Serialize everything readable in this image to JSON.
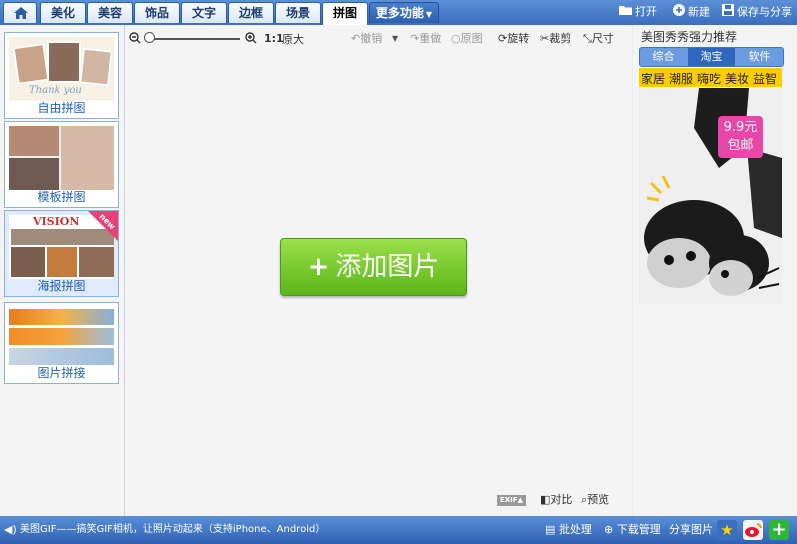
{
  "tabs": [
    "美化",
    "美容",
    "饰品",
    "文字",
    "边框",
    "场景",
    "拼图",
    "更多功能"
  ],
  "top_actions": {
    "open": "打开",
    "new": "新建",
    "save_share": "保存与分享"
  },
  "left_cards": [
    "自由拼图",
    "模板拼图",
    "海报拼图",
    "图片拼接"
  ],
  "poster_thumb_text": "VISION",
  "new_badge": "new",
  "toolbar": {
    "zoom_ratio": "1:1",
    "original_size": "原大",
    "undo": "撤销",
    "redo": "重做",
    "original": "原图",
    "rotate": "旋转",
    "crop": "裁剪",
    "size": "尺寸"
  },
  "main": {
    "add_button": "添加图片",
    "add_plus": "+"
  },
  "bottom_tools": {
    "exif": "EXIF",
    "compare": "对比",
    "preview": "预览"
  },
  "right_panel": {
    "title": "美图秀秀强力推荐",
    "tabs": [
      "综合",
      "淘宝",
      "软件"
    ],
    "categories": [
      "家居",
      "潮服",
      "嗨吃",
      "美妆",
      "益智"
    ],
    "ad_price": "9.9元",
    "ad_shipping": "包邮"
  },
  "status_bar": {
    "message": "美图GIF——搞笑GIF相机，让照片动起来（支持iPhone、Android）",
    "batch": "批处理",
    "download": "下载管理",
    "share": "分享图片"
  },
  "colors": {
    "accent": "#3b6fbf",
    "button_green": "#6cc524"
  }
}
